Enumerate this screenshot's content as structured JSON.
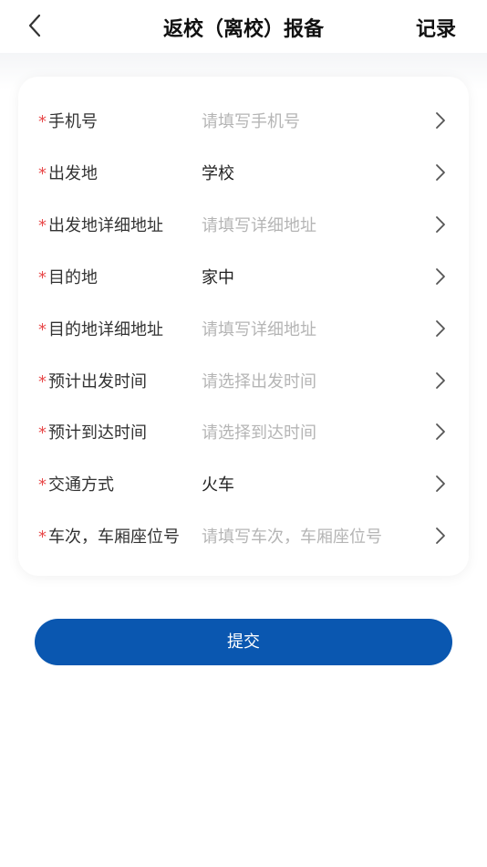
{
  "header": {
    "title": "返校（离校）报备",
    "record_label": "记录"
  },
  "form": {
    "required_mark": "*",
    "rows": [
      {
        "label": "手机号",
        "value": "请填写手机号",
        "state": "placeholder"
      },
      {
        "label": "出发地",
        "value": "学校",
        "state": "filled"
      },
      {
        "label": "出发地详细地址",
        "value": "请填写详细地址",
        "state": "placeholder"
      },
      {
        "label": "目的地",
        "value": "家中",
        "state": "filled"
      },
      {
        "label": "目的地详细地址",
        "value": "请填写详细地址",
        "state": "placeholder"
      },
      {
        "label": "预计出发时间",
        "value": "请选择出发时间",
        "state": "placeholder"
      },
      {
        "label": "预计到达时间",
        "value": "请选择到达时间",
        "state": "placeholder"
      },
      {
        "label": "交通方式",
        "value": "火车",
        "state": "filled"
      },
      {
        "label": "车次，车厢座位号",
        "value": "请填写车次，车厢座位号",
        "state": "placeholder"
      }
    ]
  },
  "submit_label": "提交",
  "colors": {
    "accent": "#0a57b0",
    "required": "#e8494a",
    "placeholder": "#b5b5b5"
  },
  "icons": {
    "back": "chevron-left-icon",
    "row_arrow": "chevron-right-icon"
  }
}
